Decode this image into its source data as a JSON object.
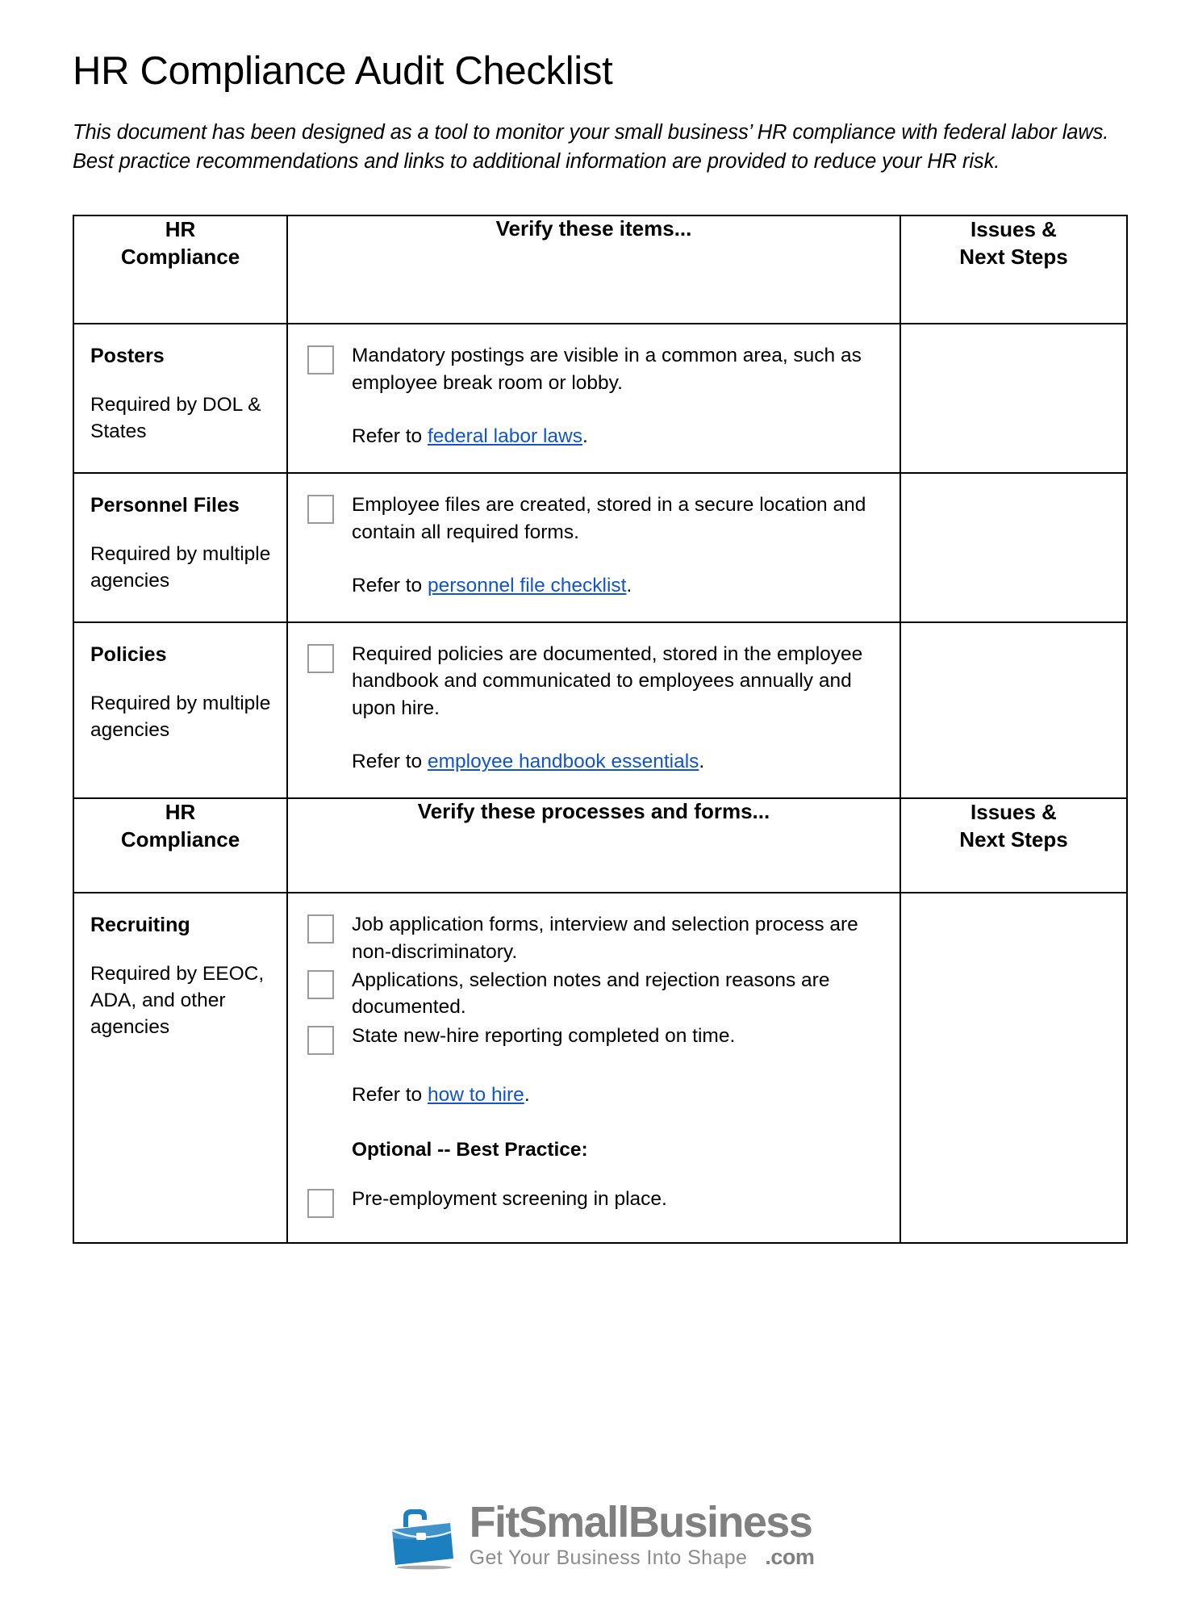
{
  "document": {
    "title": "HR Compliance Audit Checklist",
    "intro": "This document has been designed as a tool to monitor your small business’ HR compliance with federal labor laws. Best practice recommendations and links to additional information are provided to reduce your HR risk."
  },
  "colors": {
    "link": "#1155cc",
    "logo_blue": "#1b7fc0",
    "logo_gray": "#808080",
    "checkbox_border": "#9a9a9a",
    "table_border": "#000000"
  },
  "table": {
    "header_1": {
      "category": "HR\nCompliance",
      "items": "Verify these items...",
      "issues": "Issues &\nNext Steps"
    },
    "header_2": {
      "category": "HR\nCompliance",
      "items": "Verify these processes and forms...",
      "issues": "Issues &\nNext Steps"
    },
    "section_1_rows": [
      {
        "category_title": "Posters",
        "category_sub": "Required by DOL & States",
        "checks": [
          "Mandatory postings are visible in a common area, such as employee break room or lobby."
        ],
        "refer_prefix": "Refer to ",
        "refer_link": "federal labor laws",
        "refer_suffix": ".",
        "issues": ""
      },
      {
        "category_title": "Personnel Files",
        "category_sub": "Required by multiple agencies",
        "checks": [
          "Employee files are created, stored in a secure location and contain all required forms."
        ],
        "refer_prefix": "Refer to ",
        "refer_link": "personnel file checklist",
        "refer_suffix": ".",
        "issues": ""
      },
      {
        "category_title": "Policies",
        "category_sub": "Required by multiple agencies",
        "checks": [
          "Required policies are documented, stored in the employee handbook and communicated to employees annually and upon hire."
        ],
        "refer_prefix": "Refer to ",
        "refer_link": "employee handbook essentials",
        "refer_suffix": ".",
        "issues": ""
      }
    ],
    "section_2_rows": [
      {
        "category_title": "Recruiting",
        "category_sub": "Required by EEOC, ADA, and other agencies",
        "checks": [
          "Job application forms, interview and selection process are non-discriminatory.",
          "Applications, selection notes and rejection reasons are documented.",
          "State new-hire reporting completed on time."
        ],
        "refer_prefix": "Refer to ",
        "refer_link": "how to hire",
        "refer_suffix": ".",
        "optional_heading": "Optional -- Best Practice:",
        "optional_checks": [
          "Pre-employment screening in place."
        ],
        "issues": ""
      }
    ]
  },
  "footer": {
    "logo_icon": "briefcase-icon",
    "logo_name": "FitSmallBusiness",
    "logo_tagline": "Get Your Business Into Shape",
    "logo_tld": ".com"
  }
}
